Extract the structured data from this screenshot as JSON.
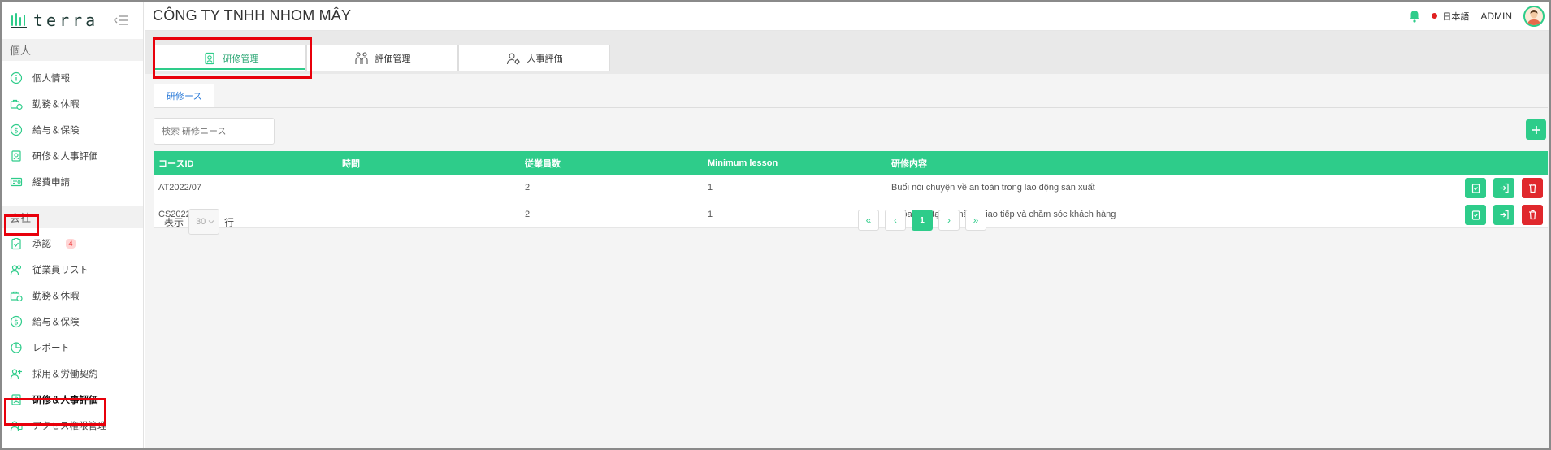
{
  "brand": {
    "name": "terra"
  },
  "header": {
    "company": "CÔNG TY TNHH NHOM MÂY",
    "language": "日本語",
    "user": "ADMIN"
  },
  "sidebar": {
    "personal_title": "個人",
    "personal_items": [
      {
        "label": "個人情報",
        "icon": "info-icon"
      },
      {
        "label": "勤務＆休暇",
        "icon": "work-leave-icon"
      },
      {
        "label": "給与＆保険",
        "icon": "salary-icon"
      },
      {
        "label": "研修＆人事評価",
        "icon": "training-icon"
      },
      {
        "label": "経費申請",
        "icon": "expense-icon"
      }
    ],
    "company_title": "会社",
    "company_items": [
      {
        "label": "承認",
        "icon": "approval-icon",
        "badge": "4"
      },
      {
        "label": "従業員リスト",
        "icon": "employees-icon"
      },
      {
        "label": "勤務＆休暇",
        "icon": "work-leave-icon"
      },
      {
        "label": "給与＆保険",
        "icon": "salary-icon"
      },
      {
        "label": "レポート",
        "icon": "report-icon"
      },
      {
        "label": "採用＆労働契約",
        "icon": "recruit-icon"
      },
      {
        "label": "研修＆人事評価",
        "icon": "training-icon",
        "active": true
      },
      {
        "label": "アクセス権限管理",
        "icon": "access-icon"
      }
    ]
  },
  "tabs": [
    {
      "label": "研修管理",
      "active": true
    },
    {
      "label": "評価管理"
    },
    {
      "label": "人事評価"
    }
  ],
  "subtab": "研修ース",
  "search": {
    "placeholder": "検索 研修ニース"
  },
  "table": {
    "headers": [
      "コースID",
      "時間",
      "従業員数",
      "Minimum lesson",
      "研修内容"
    ],
    "rows": [
      {
        "id": "AT2022/07",
        "time": "",
        "employees": "2",
        "min_lesson": "1",
        "content": "Buổi nói chuyện về an toàn trong lao động sản xuất"
      },
      {
        "id": "CS2022/07",
        "time": "",
        "employees": "2",
        "min_lesson": "1",
        "content": "Khóa đào tạo kỹ năng giao tiếp và chăm sóc khách hàng"
      }
    ]
  },
  "footer": {
    "show_label": "表示",
    "page_size": "30",
    "rows_label": "行",
    "pager": {
      "first": "«",
      "prev": "‹",
      "current": "1",
      "next": "›",
      "last": "»"
    }
  },
  "colors": {
    "accent": "#2ecc8a",
    "danger": "#e0282d",
    "highlight": "#e8000b"
  }
}
